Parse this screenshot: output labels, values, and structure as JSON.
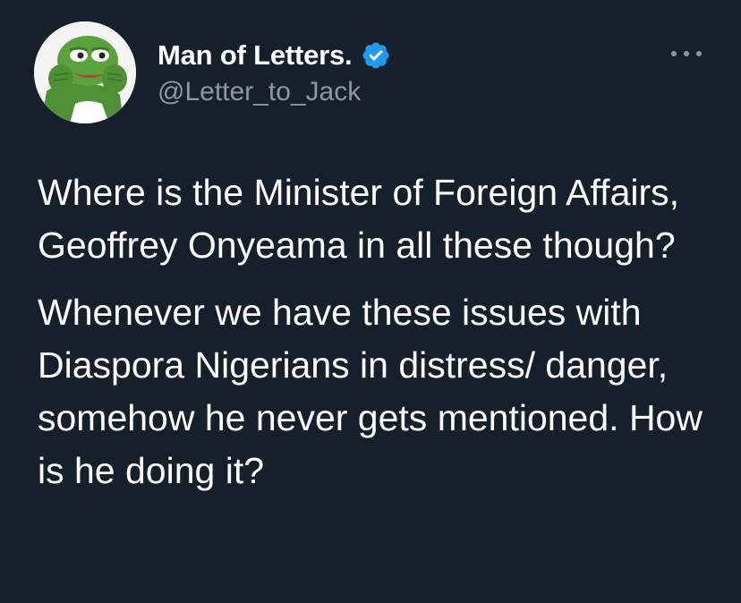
{
  "tweet": {
    "author": {
      "display_name": "Man of Letters.",
      "handle": "@Letter_to_Jack",
      "verified": true
    },
    "more_icon": "more-horizontal-icon",
    "verified_icon": "verified-badge-icon",
    "paragraphs": [
      "Where is the Minister of Foreign Affairs, Geoffrey Onyeama in all these though?",
      "Whenever we have these issues with Diaspora Nigerians in distress/ danger, somehow he never gets mentioned. How is he doing it?"
    ]
  },
  "colors": {
    "background": "#15202b",
    "text_primary": "#ffffff",
    "text_secondary": "#8b98a5",
    "verified": "#1d9bf0"
  }
}
